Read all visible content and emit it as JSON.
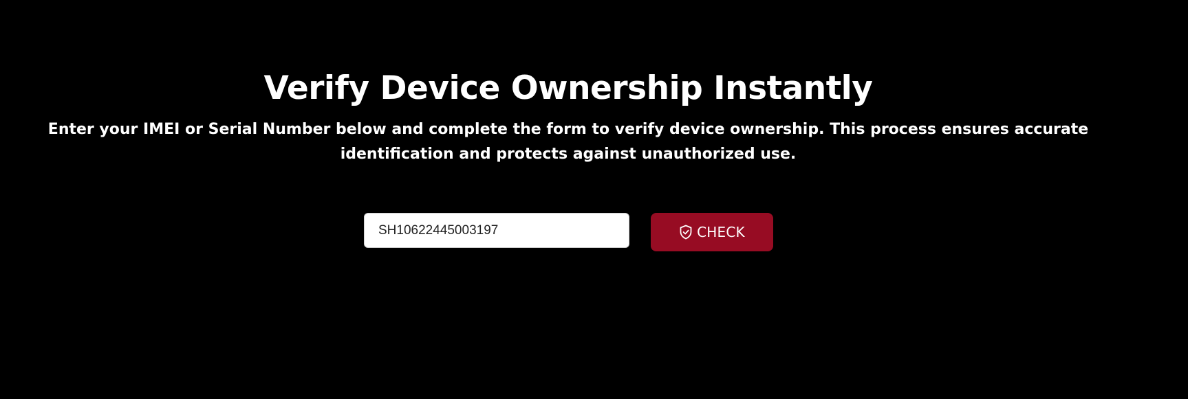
{
  "hero": {
    "title": "Verify Device Ownership Instantly",
    "subtitle": "Enter your IMEI or Serial Number below and complete the form to verify device ownership. This process ensures accurate identification and protects against unauthorized use."
  },
  "form": {
    "serial_value": "SH10622445003197",
    "check_label": "CHECK",
    "check_icon": "shield-check-icon"
  },
  "colors": {
    "background": "#000000",
    "accent": "#970c23",
    "text": "#ffffff"
  }
}
